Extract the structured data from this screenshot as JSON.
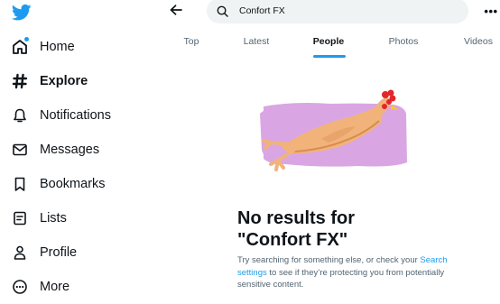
{
  "sidebar": {
    "logo_icon": "twitter-bird-icon",
    "items": [
      {
        "label": "Home",
        "icon": "home-icon"
      },
      {
        "label": "Explore",
        "icon": "hashtag-icon"
      },
      {
        "label": "Notifications",
        "icon": "bell-icon"
      },
      {
        "label": "Messages",
        "icon": "envelope-icon"
      },
      {
        "label": "Bookmarks",
        "icon": "bookmark-icon"
      },
      {
        "label": "Lists",
        "icon": "list-icon"
      },
      {
        "label": "Profile",
        "icon": "person-icon"
      },
      {
        "label": "More",
        "icon": "more-circle-icon"
      }
    ]
  },
  "header": {
    "search_value": "Confort FX",
    "more_label": "•••"
  },
  "tabs": [
    "Top",
    "Latest",
    "People",
    "Photos",
    "Videos"
  ],
  "active_tab": "People",
  "empty_state": {
    "title_line1": "No results for",
    "title_line2": "\"Confort FX\"",
    "body_before": "Try searching for something else, or check your ",
    "body_link": "Search settings",
    "body_after": " to see if they’re protecting you from potentially sensitive content."
  },
  "colors": {
    "accent": "#1d9bf0",
    "text": "#0f1419",
    "secondary_text": "#536471",
    "search_bg": "#eff3f4",
    "illustration_bg": "#d9a6e3"
  }
}
